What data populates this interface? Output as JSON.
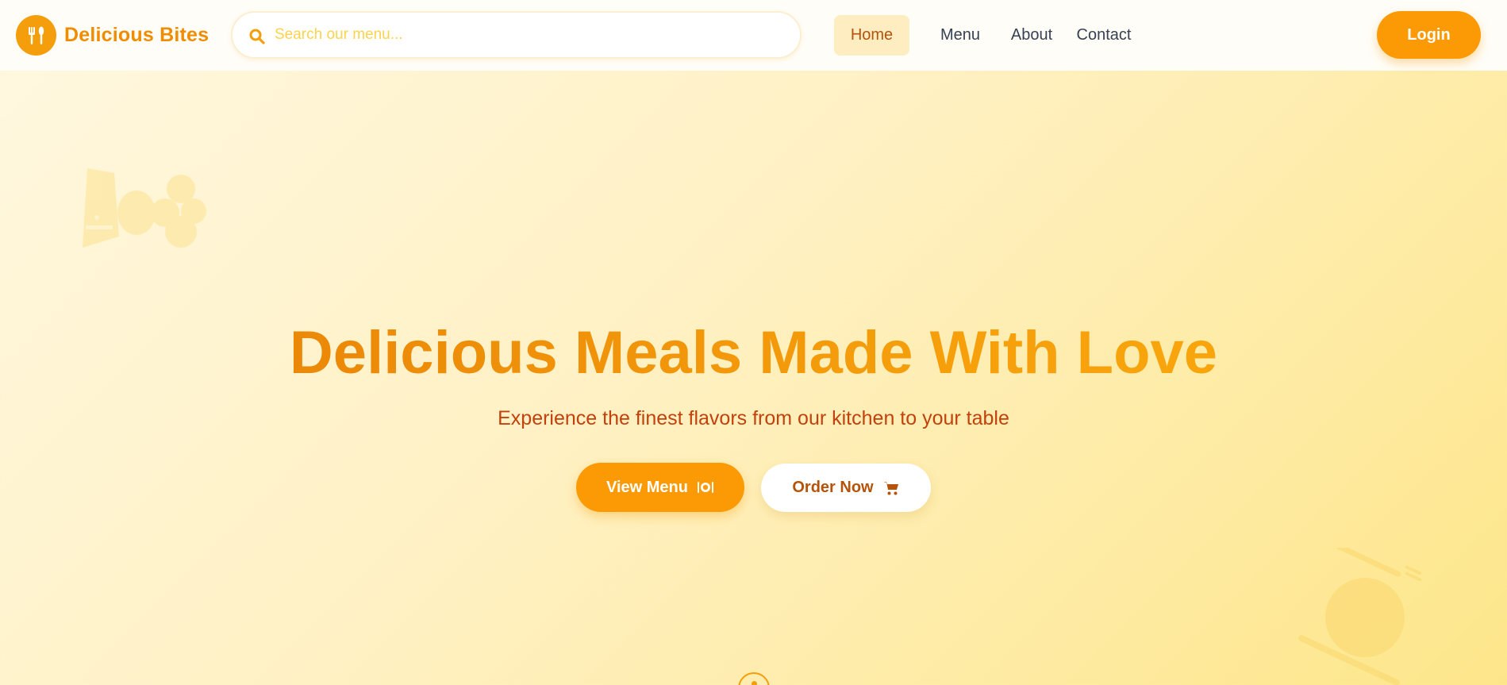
{
  "brand": {
    "name": "Delicious Bites",
    "logo_icon": "utensils-icon"
  },
  "search": {
    "placeholder": "Search our menu...",
    "value": "",
    "icon": "search-icon"
  },
  "nav": {
    "items": [
      {
        "label": "Home",
        "active": true
      },
      {
        "label": "Menu",
        "active": false
      },
      {
        "label": "About",
        "active": false
      },
      {
        "label": "Contact",
        "active": false
      }
    ]
  },
  "auth": {
    "login_label": "Login"
  },
  "hero": {
    "title": "Delicious Meals Made With Love",
    "subtitle": "Experience the finest flavors from our kitchen to your table",
    "primary_cta": {
      "label": "View Menu",
      "icon": "plate-utensils-icon"
    },
    "secondary_cta": {
      "label": "Order Now",
      "icon": "cart-icon"
    }
  },
  "colors": {
    "accent": "#fb9a05",
    "brand_text": "#f08c00",
    "subtitle_text": "#c2410c",
    "nav_active_bg": "#fdedc0",
    "background_start": "#fff8e1",
    "background_end": "#fde68a"
  }
}
